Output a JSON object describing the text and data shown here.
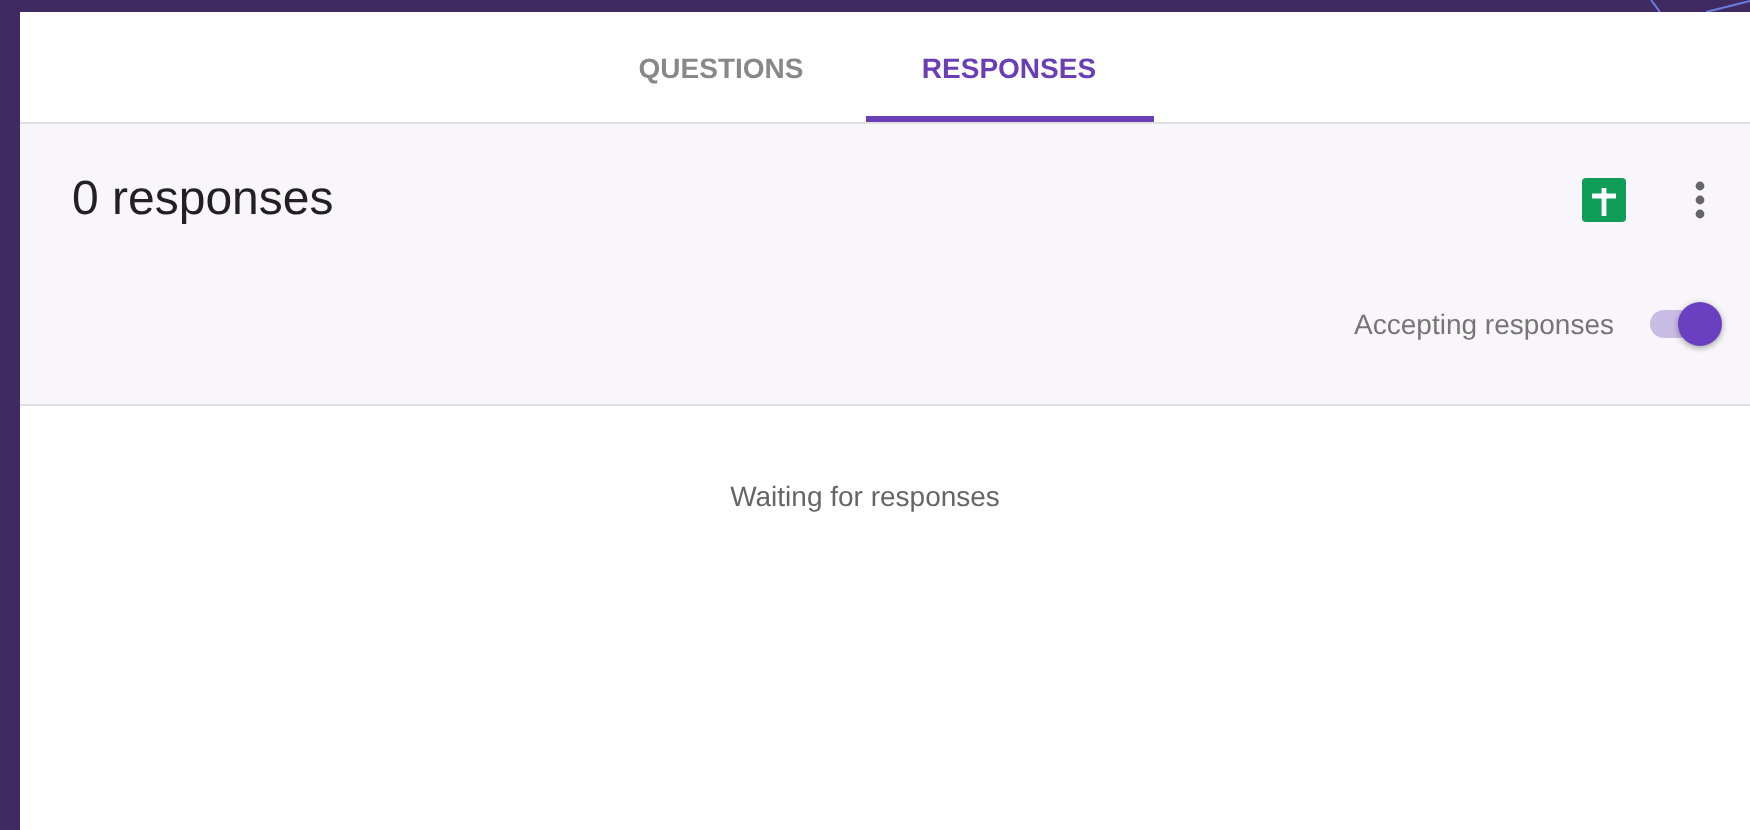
{
  "tabs": [
    {
      "label": "QUESTIONS",
      "selected": false
    },
    {
      "label": "RESPONSES",
      "selected": true
    }
  ],
  "summary": {
    "title": "0 responses",
    "accepting_label": "Accepting responses",
    "accepting": {
      "on": true
    }
  },
  "empty_message": "Waiting for responses"
}
